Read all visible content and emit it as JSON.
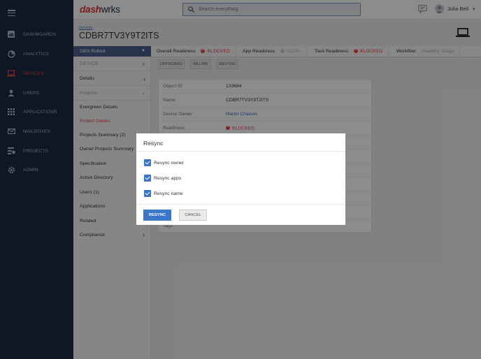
{
  "app": {
    "logo_part1": "dash",
    "logo_part2": "w",
    "logo_part3": "rks"
  },
  "search": {
    "placeholder": "Search everything"
  },
  "user": {
    "name": "Julia Bell"
  },
  "nav": {
    "items": [
      {
        "label": "DASHBOARDS",
        "icon": "dashboard-icon"
      },
      {
        "label": "ANALYTICS",
        "icon": "analytics-icon"
      },
      {
        "label": "DEVICES",
        "icon": "laptop-icon",
        "active": true
      },
      {
        "label": "USERS",
        "icon": "user-icon"
      },
      {
        "label": "APPLICATIONS",
        "icon": "grid-icon"
      },
      {
        "label": "MAILBOXES",
        "icon": "mail-icon"
      },
      {
        "label": "PROJECTS",
        "icon": "projects-icon"
      },
      {
        "label": "ADMIN",
        "icon": "gear-icon"
      }
    ]
  },
  "page": {
    "breadcrumb": "Devices",
    "title": "CDBR7TV3Y9T2ITS"
  },
  "sidepanel": {
    "rollout": "1803 Rollout",
    "device_header": "DEVICE",
    "details": "Details",
    "projects_header": "Projects",
    "links": [
      "Evergreen Details",
      "Project Details",
      "Projects Summary (2)",
      "Owner Projects Summary",
      "Specification",
      "Active Directory",
      "Users (1)",
      "Applications",
      "Related",
      "Compliance"
    ],
    "active_link": "Project Details"
  },
  "tabs": [
    {
      "label": "Overall Readiness",
      "status": "BLOCKED"
    },
    {
      "label": "App Readiness",
      "status": "NONE"
    },
    {
      "label": "Task Readiness",
      "status": "BLOCKED"
    },
    {
      "label": "Workflow",
      "status": "Awaiting Triage"
    }
  ],
  "actions": {
    "offboard": "OFFBOARD",
    "relink": "RELINK",
    "resync": "RESYNC"
  },
  "details": {
    "object_id_label": "Object ID",
    "object_id": "133684",
    "name_label": "Name",
    "name": "CDBR7TV3Y9T2ITS",
    "owner_label": "Device Owner",
    "owner": "Martin Chauvin",
    "readiness_label": "Readiness",
    "readiness": "BLOCKED",
    "tags_label": "Tags"
  },
  "modal": {
    "title": "Resync",
    "options": [
      "Resync owner",
      "Resync apps",
      "Resync name"
    ],
    "checked": [
      true,
      true,
      true
    ],
    "resync_button": "RESYNC",
    "cancel_button": "CANCEL"
  },
  "colors": {
    "accent": "#3b74c8",
    "danger": "#e8434a",
    "nav_bg": "#1d2942"
  }
}
